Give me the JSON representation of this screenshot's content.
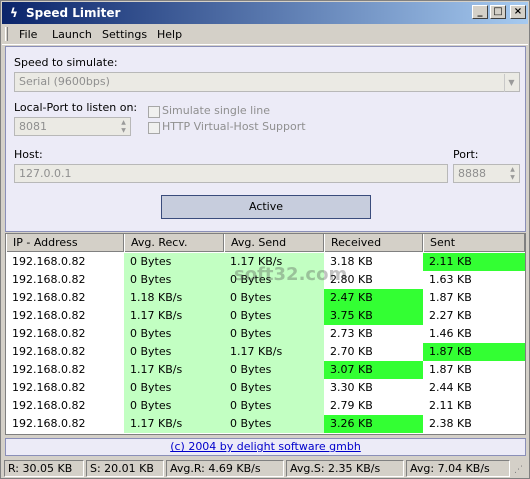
{
  "window": {
    "title": "Speed Limiter",
    "icon": "lightning-icon",
    "min_glyph": "_",
    "max_glyph": "□",
    "close_glyph": "×"
  },
  "menu": [
    "File",
    "Launch",
    "Settings",
    "Help"
  ],
  "form": {
    "speed_label": "Speed to simulate:",
    "speed_value": "Serial (9600bps)",
    "port_label": "Local-Port to listen on:",
    "port_value": "8081",
    "simulate_single_line": "Simulate single line",
    "http_vhost": "HTTP Virtual-Host Support",
    "host_label": "Host:",
    "host_value": "127.0.0.1",
    "hostport_label": "Port:",
    "hostport_value": "8888",
    "active_button": "Active"
  },
  "table": {
    "headers": [
      "IP - Address",
      "Avg. Recv. Speed",
      "Avg. Send Speed",
      "Received",
      "Sent"
    ],
    "rows": [
      {
        "ip": "192.168.0.82",
        "recv": "0 Bytes",
        "send": "1.17 KB/s",
        "received": "3.18 KB",
        "sent": "2.11 KB",
        "hi_received": false,
        "hi_sent": true
      },
      {
        "ip": "192.168.0.82",
        "recv": "0 Bytes",
        "send": "0 Bytes",
        "received": "2.80 KB",
        "sent": "1.63 KB",
        "hi_received": false,
        "hi_sent": false
      },
      {
        "ip": "192.168.0.82",
        "recv": "1.18 KB/s",
        "send": "0 Bytes",
        "received": "2.47 KB",
        "sent": "1.87 KB",
        "hi_received": true,
        "hi_sent": false
      },
      {
        "ip": "192.168.0.82",
        "recv": "1.17 KB/s",
        "send": "0 Bytes",
        "received": "3.75 KB",
        "sent": "2.27 KB",
        "hi_received": true,
        "hi_sent": false
      },
      {
        "ip": "192.168.0.82",
        "recv": "0 Bytes",
        "send": "0 Bytes",
        "received": "2.73 KB",
        "sent": "1.46 KB",
        "hi_received": false,
        "hi_sent": false
      },
      {
        "ip": "192.168.0.82",
        "recv": "0 Bytes",
        "send": "1.17 KB/s",
        "received": "2.70 KB",
        "sent": "1.87 KB",
        "hi_received": false,
        "hi_sent": true
      },
      {
        "ip": "192.168.0.82",
        "recv": "1.17 KB/s",
        "send": "0 Bytes",
        "received": "3.07 KB",
        "sent": "1.87 KB",
        "hi_received": true,
        "hi_sent": false
      },
      {
        "ip": "192.168.0.82",
        "recv": "0 Bytes",
        "send": "0 Bytes",
        "received": "3.30 KB",
        "sent": "2.44 KB",
        "hi_received": false,
        "hi_sent": false
      },
      {
        "ip": "192.168.0.82",
        "recv": "0 Bytes",
        "send": "0 Bytes",
        "received": "2.79 KB",
        "sent": "2.11 KB",
        "hi_received": false,
        "hi_sent": false
      },
      {
        "ip": "192.168.0.82",
        "recv": "1.17 KB/s",
        "send": "0 Bytes",
        "received": "3.26 KB",
        "sent": "2.38 KB",
        "hi_received": true,
        "hi_sent": false
      }
    ]
  },
  "footer_link": "(c) 2004 by delight software gmbh",
  "watermark": "soft32.com",
  "status": {
    "r": "R: 30.05 KB",
    "s": "S: 20.01 KB",
    "avg_r": "Avg.R: 4.69 KB/s",
    "avg_s": "Avg.S: 2.35 KB/s",
    "avg": "Avg: 7.04 KB/s"
  },
  "colors": {
    "speed_cell": "#c2ffc2",
    "highlight_cell": "#33ff33",
    "panel_bg": "#ecebf7"
  }
}
